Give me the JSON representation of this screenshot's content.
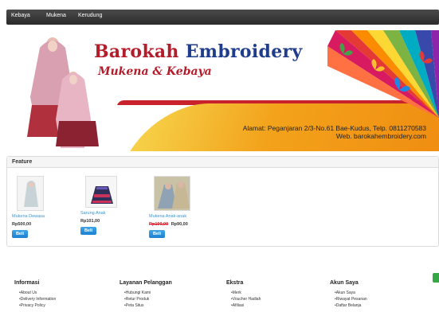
{
  "topnav": {
    "items": [
      "Kebaya",
      "Mukena",
      "Kerudung"
    ]
  },
  "banner": {
    "title_word1": "Barokah",
    "title_word2": "Embroidery",
    "subtitle": "Mukena & Kebaya",
    "address": "Alamat: Peganjaran 2/3-No.61 Bae-Kudus, Telp. 0811270583",
    "website": "Web. barokahembroidery.com"
  },
  "feature": {
    "heading": "Feature",
    "products": [
      {
        "name": "Mukena Dewasa",
        "price": "Rp500,00",
        "old_price": "",
        "button": "Beli"
      },
      {
        "name": "Sarung Anak",
        "price": "Rp101,00",
        "old_price": "",
        "button": "Beli"
      },
      {
        "name": "Mukena Anak-anak",
        "price": "Rp90,00",
        "old_price": "Rp100,00",
        "button": "Beli"
      }
    ]
  },
  "footer": {
    "columns": [
      {
        "title": "Informasi",
        "links": [
          "About Us",
          "Delivery Information",
          "Privacy Policy"
        ]
      },
      {
        "title": "Layanan Pelanggan",
        "links": [
          "Hubungi Kami",
          "Retur Produk",
          "Peta Situs"
        ]
      },
      {
        "title": "Ekstra",
        "links": [
          "Merk",
          "Voucher Hadiah",
          "Afiliasi"
        ]
      },
      {
        "title": "Akun Saya",
        "links": [
          "Akun Saya",
          "Riwayat Pesanan",
          "Daftar Belanja"
        ]
      }
    ]
  },
  "colors": {
    "nav_bg": "#333333",
    "brand_blue": "#1f3d8a",
    "brand_red": "#b31c2a",
    "button_blue": "#1c7fd0",
    "link_blue": "#3a95d0"
  }
}
